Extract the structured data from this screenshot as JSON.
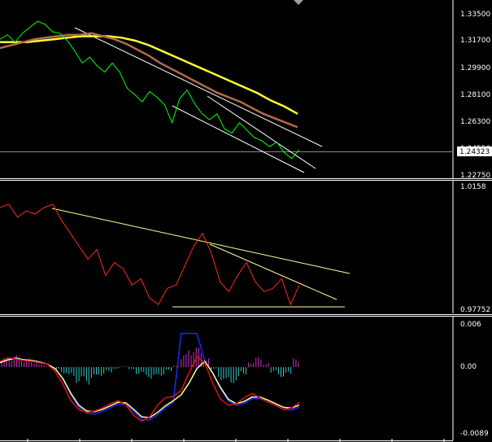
{
  "colors": {
    "background": "#000000",
    "separator": "#ffffff",
    "price_line": "#00ff00",
    "ma_fast": "#b06a4a",
    "ma_slow": "#ffff33",
    "trend_line": "#ffffff",
    "oscillator_line": "#ff2a1a",
    "oscillator_trend": "#ffff99",
    "hist_positive": "#cc33cc",
    "hist_negative": "#33cccc",
    "macd_signal": "#ffff99",
    "macd_main": "#dd1111",
    "blue_line": "#1a2aff"
  },
  "chart_data": [
    {
      "type": "line",
      "pane": "price",
      "y_ticks": [
        "1.33500",
        "1.31700",
        "1.29900",
        "1.28100",
        "1.26300",
        "1.24550",
        "1.22750"
      ],
      "current_price": "1.24323",
      "ylim": [
        1.2275,
        1.335
      ],
      "series": [
        {
          "values": [
            1.318,
            1.321,
            1.316,
            1.322,
            1.326,
            1.33,
            1.328,
            1.323,
            1.322,
            1.317,
            1.31,
            1.302,
            1.306,
            1.3,
            1.296,
            1.302,
            1.296,
            1.285,
            1.281,
            1.276,
            1.283,
            1.279,
            1.274,
            1.262,
            1.278,
            1.284,
            1.275,
            1.268,
            1.264,
            1.268,
            1.258,
            1.255,
            1.262,
            1.257,
            1.252,
            1.25,
            1.246,
            1.249,
            1.242,
            1.238,
            1.244
          ]
        },
        {
          "values": [
            1.312,
            1.314,
            1.316,
            1.318,
            1.319,
            1.32,
            1.321,
            1.321,
            1.322,
            1.32,
            1.318,
            1.315,
            1.311,
            1.307,
            1.302,
            1.298,
            1.294,
            1.29,
            1.286,
            1.282,
            1.279,
            1.276,
            1.272,
            1.268,
            1.265,
            1.262,
            1.259
          ]
        },
        {
          "values": [
            1.316,
            1.316,
            1.316,
            1.317,
            1.318,
            1.319,
            1.32,
            1.32,
            1.32,
            1.319,
            1.317,
            1.314,
            1.31,
            1.306,
            1.302,
            1.298,
            1.294,
            1.29,
            1.286,
            1.282,
            1.277,
            1.273,
            1.268
          ]
        }
      ]
    },
    {
      "type": "line",
      "pane": "oscillator",
      "y_ticks": [
        "1.0158",
        "0.97752"
      ],
      "ylim": [
        0.97752,
        1.0158
      ],
      "series": [
        {
          "values": [
            1.009,
            1.01,
            1.006,
            1.008,
            1.007,
            1.009,
            1.01,
            1.005,
            1.001,
            0.997,
            0.993,
            0.996,
            0.988,
            0.992,
            0.99,
            0.985,
            0.987,
            0.981,
            0.979,
            0.984,
            0.985,
            0.991,
            0.997,
            1.001,
            0.995,
            0.986,
            0.983,
            0.988,
            0.992,
            0.986,
            0.983,
            0.984,
            0.987,
            0.979,
            0.985
          ]
        }
      ]
    },
    {
      "type": "bar",
      "pane": "macd",
      "y_ticks": [
        "0.006",
        "0.00",
        "-0.0089"
      ],
      "ylim": [
        -0.0089,
        0.006
      ],
      "series": [
        {
          "values": [
            0.0012,
            0.0018,
            0.0016,
            0.0012,
            0.0009,
            0.0004,
            0.0002,
            -0.0004,
            -0.0009,
            -0.0016,
            -0.0022,
            -0.0024,
            -0.0018,
            -0.0012,
            -0.0008,
            -0.0003,
            0.0001,
            -0.0004,
            -0.001,
            -0.0014,
            -0.0018,
            -0.0012,
            -0.0006,
            0.0002,
            0.0018,
            0.0032,
            0.0028,
            0.0012,
            -0.0004,
            -0.0018,
            -0.0026,
            -0.0022,
            -0.001,
            0.0008,
            0.0014,
            0.0006,
            -0.0008,
            -0.0014,
            -0.0012,
            0.0012
          ]
        },
        {
          "values": [
            0.0008,
            0.0013,
            0.0011,
            0.0009,
            0.0008,
            0.0006,
            0.0004,
            -0.0006,
            -0.0024,
            -0.0046,
            -0.0058,
            -0.0062,
            -0.006,
            -0.0056,
            -0.005,
            -0.0046,
            -0.0052,
            -0.0066,
            -0.0074,
            -0.0068,
            -0.0052,
            -0.0042,
            -0.004,
            -0.0032,
            -0.0008,
            0.0014,
            0.0006,
            -0.0022,
            -0.0044,
            -0.0052,
            -0.005,
            -0.0042,
            -0.0036,
            -0.0042,
            -0.0048,
            -0.0052,
            -0.0058,
            -0.0056,
            -0.0048
          ]
        },
        {
          "values": [
            0.0006,
            0.001,
            0.0012,
            0.001,
            0.0009,
            0.0007,
            0.0004,
            -0.0002,
            -0.0016,
            -0.0036,
            -0.0052,
            -0.006,
            -0.0061,
            -0.0058,
            -0.0053,
            -0.0048,
            -0.0049,
            -0.0058,
            -0.0068,
            -0.0069,
            -0.0062,
            -0.0053,
            -0.0046,
            -0.0038,
            -0.0022,
            -0.0002,
            0.0008,
            -0.0008,
            -0.0028,
            -0.0044,
            -0.005,
            -0.0047,
            -0.0041,
            -0.0041,
            -0.0045,
            -0.005,
            -0.0055,
            -0.0056,
            -0.0052
          ]
        }
      ]
    }
  ]
}
